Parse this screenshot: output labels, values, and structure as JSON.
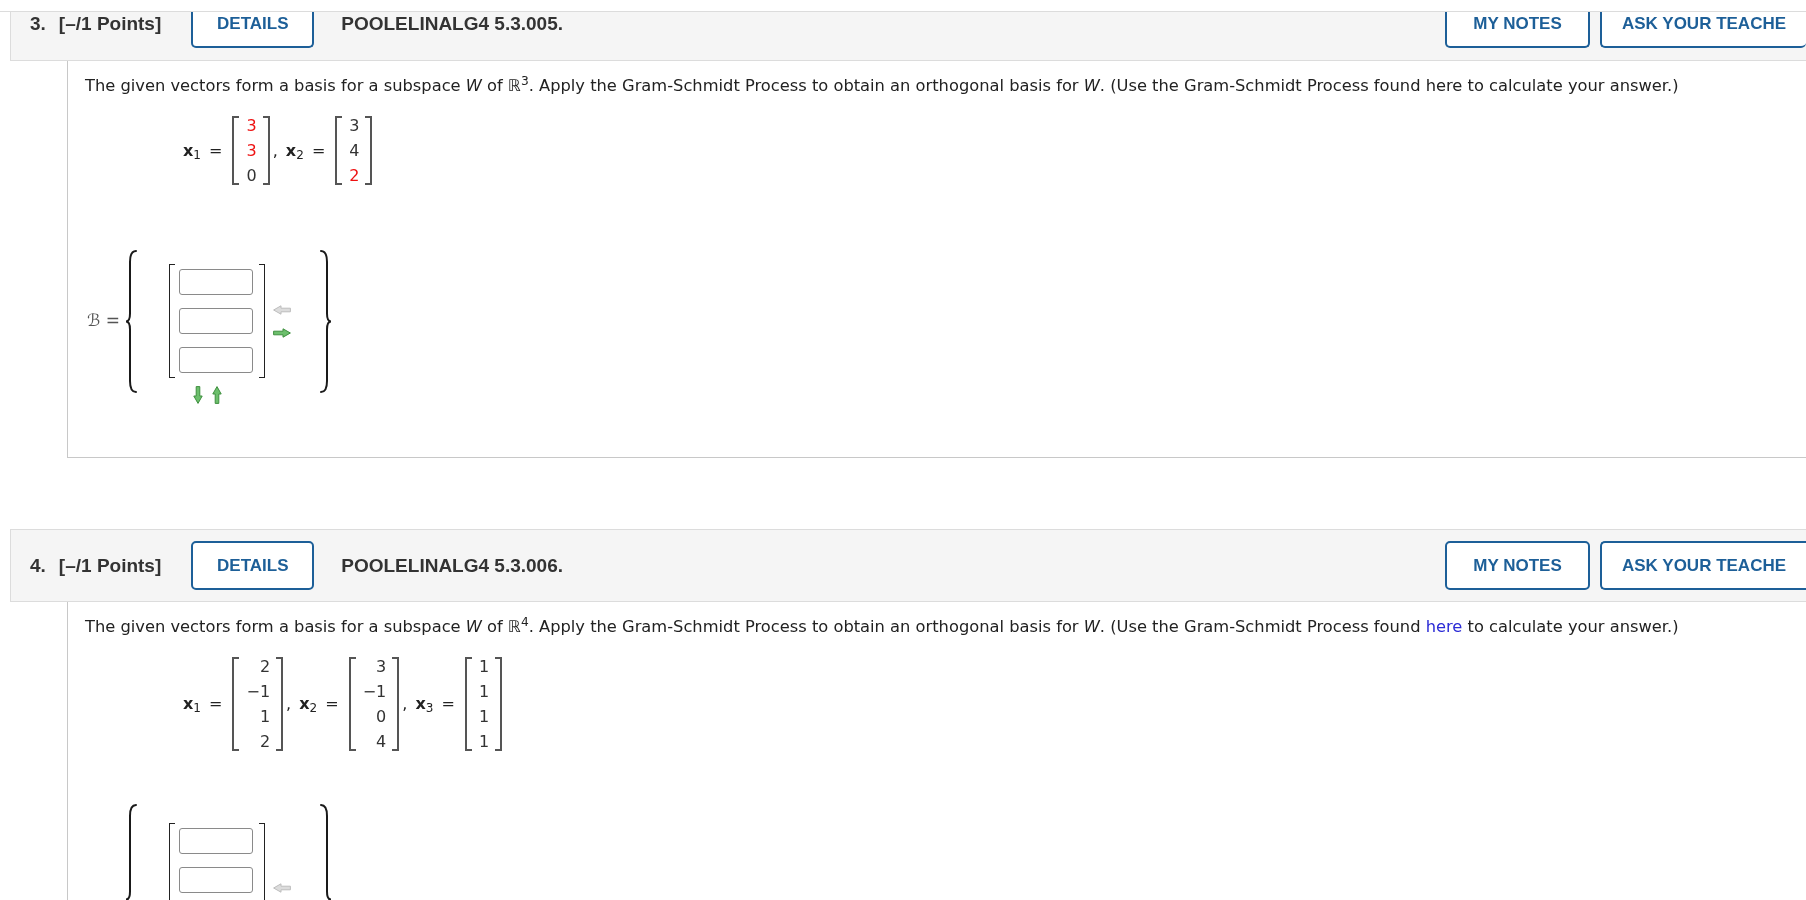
{
  "questions": [
    {
      "header": {
        "cut_off": true,
        "number": "3.",
        "points": "[–/1 Points]",
        "details_button": "DETAILS",
        "code": "POOLELINALG4 5.3.005.",
        "buttons": [
          "MY NOTES",
          "ASK YOUR TEACHE"
        ]
      },
      "prompt": [
        {
          "kind": "text",
          "text": "The given vectors form a basis for a subspace *W* of ℝ$^{3}$. Apply the Gram-Schmidt Process to obtain an orthogonal basis for *W*. (Use the Gram-Schmidt Process found here to calculate your answer.)"
        }
      ],
      "vectors": [
        {
          "label": "**x**$_{1}$ =",
          "entries": [
            {
              "value": "3",
              "color": "#ee1111"
            },
            {
              "value": "3",
              "color": "#ee1111"
            },
            {
              "value": "0",
              "color": "#333333"
            }
          ]
        },
        {
          "label": ", **x**$_{2}$ =",
          "entries": [
            {
              "value": "3",
              "color": "#333333"
            },
            {
              "value": "4",
              "color": "#333333"
            },
            {
              "value": "2",
              "color": "#ee1111"
            }
          ]
        }
      ],
      "answer": {
        "label": "ℬ =",
        "cut_off": false,
        "fields": [
          {
            "kind": "blank"
          },
          {
            "kind": "blank"
          },
          {
            "kind": "blank"
          }
        ],
        "column_arrows": [
          {
            "kind": "left",
            "disabled": true
          },
          {
            "kind": "right",
            "disabled": false
          }
        ],
        "row_arrows": [
          {
            "kind": "down",
            "disabled": false
          },
          {
            "kind": "up",
            "disabled": false
          }
        ]
      }
    },
    {
      "header": {
        "cut_off": false,
        "number": "4.",
        "points": "[–/1 Points]",
        "details_button": "DETAILS",
        "code": "POOLELINALG4 5.3.006.",
        "buttons": [
          "MY NOTES",
          "ASK YOUR TEACHE"
        ]
      },
      "prompt": [
        {
          "kind": "text",
          "text": "The given vectors form a basis for a subspace *W* of ℝ$^{4}$. Apply the Gram-Schmidt Process to obtain an orthogonal basis for *W*. (Use the Gram-Schmidt Process found "
        },
        {
          "kind": "link",
          "text": "here"
        },
        {
          "kind": "text",
          "text": " to calculate your answer.)"
        }
      ],
      "vectors": [
        {
          "label": "**x**$_{1}$ =",
          "entries": [
            {
              "value": "2",
              "color": "#333333"
            },
            {
              "value": "−1",
              "color": "#333333"
            },
            {
              "value": "1",
              "color": "#333333"
            },
            {
              "value": "2",
              "color": "#333333"
            }
          ]
        },
        {
          "label": ", **x**$_{2}$ =",
          "entries": [
            {
              "value": "3",
              "color": "#333333"
            },
            {
              "value": "−1",
              "color": "#333333"
            },
            {
              "value": "0",
              "color": "#333333"
            },
            {
              "value": "4",
              "color": "#333333"
            }
          ]
        },
        {
          "label": ", **x**$_{3}$ =",
          "entries": [
            {
              "value": "1",
              "color": "#333333"
            },
            {
              "value": "1",
              "color": "#333333"
            },
            {
              "value": "1",
              "color": "#333333"
            },
            {
              "value": "1",
              "color": "#333333"
            }
          ]
        }
      ],
      "answer": {
        "cut_off": true,
        "fields": [
          {
            "kind": "blank"
          },
          {
            "kind": "blank"
          }
        ],
        "column_arrows": [
          {
            "kind": "left",
            "disabled": true
          }
        ]
      }
    }
  ]
}
